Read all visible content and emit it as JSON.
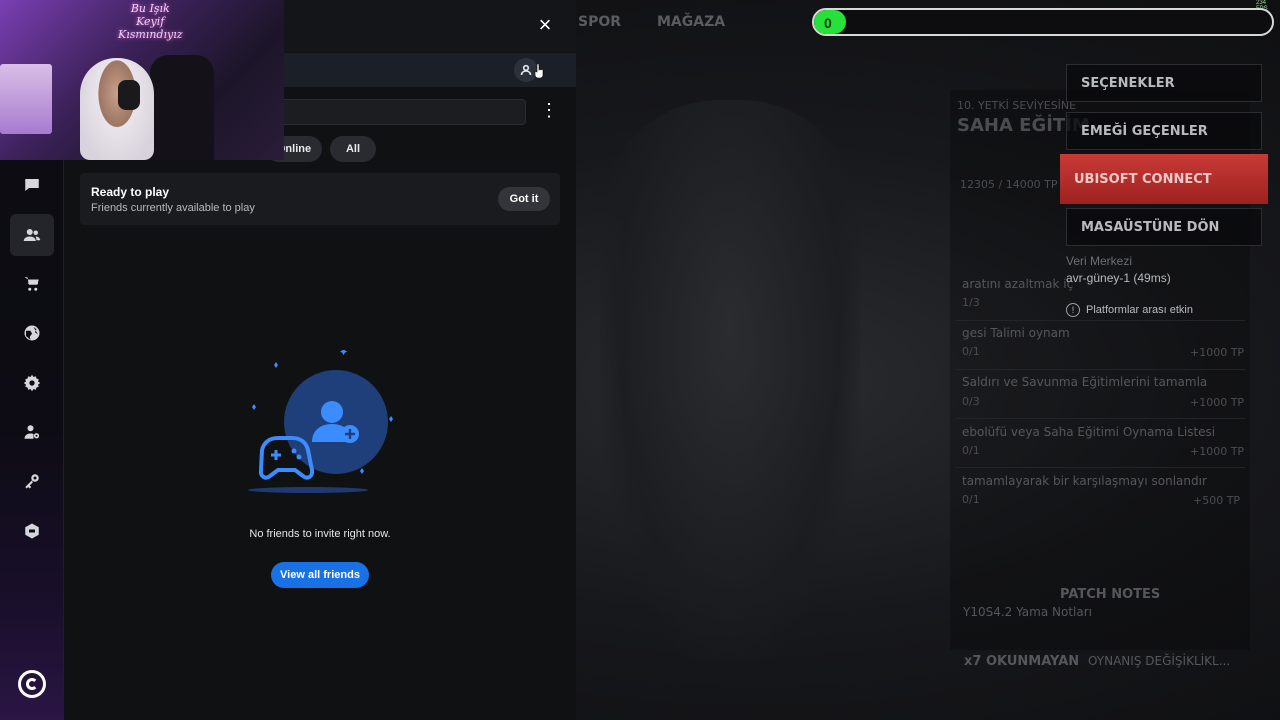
{
  "game": {
    "nav": [
      "SPOR",
      "MAĞAZA"
    ],
    "progress_value": "0",
    "progress_fraction": 0.07,
    "fps_label": "234 FPS",
    "left_column": {
      "rank_label": "10. YETKİ SEVİYESİNE",
      "training_title": "SAHA EĞİTİM",
      "tp_counter": "12305 / 14000 TP",
      "challenges": [
        {
          "text": "aratını azaltmak iç",
          "count": "1/3",
          "reward": ""
        },
        {
          "text": "gesi Talimi oynam",
          "count": "0/1",
          "reward": "+1000 TP"
        },
        {
          "text": "Saldırı ve Savunma Eğitimlerini tamamla",
          "count": "0/3",
          "reward": "+1000 TP"
        },
        {
          "text": "ebolüfü veya Saha Eğitimi Oynama Listesi",
          "count": "0/1",
          "reward": "+1000 TP"
        },
        {
          "text": "tamamlayarak bir karşılaşmayı sonlandır",
          "count": "0/1",
          "reward": "+500 TP"
        }
      ],
      "patch_notes_label": "PATCH NOTES",
      "patch_notes_value": "Y10S4.2 Yama Notları",
      "unread_label": "x7 OKUNMAYAN",
      "changes_label": "OYNANIŞ DEĞİŞİKLİKL..."
    },
    "menu": {
      "options": "SEÇENEKLER",
      "credits": "EMEĞİ GEÇENLER",
      "ubisoft_connect": "UBISOFT CONNECT",
      "desktop": "MASAÜSTÜNE DÖN"
    },
    "datacenter_title": "Veri Merkezi",
    "datacenter_value": "avr-güney-1 (49ms)",
    "crossplay": "Platformlar arası etkin"
  },
  "sidebar": {
    "items": [
      {
        "name": "chat-icon"
      },
      {
        "name": "friends-icon",
        "active": true
      },
      {
        "name": "cart-icon"
      },
      {
        "name": "globe-icon"
      },
      {
        "name": "gear-icon"
      },
      {
        "name": "account-settings-icon"
      },
      {
        "name": "key-icon"
      },
      {
        "name": "game-icon"
      }
    ],
    "logo": "ubisoft-logo"
  },
  "friends_panel": {
    "close_label": "×",
    "search_placeholder": "",
    "filters": [
      "Online",
      "All"
    ],
    "ready_card": {
      "title": "Ready to play",
      "subtitle": "Friends currently available to play",
      "button": "Got it"
    },
    "empty_message": "No friends to invite right now.",
    "view_all_button": "View all friends"
  },
  "webcam": {
    "sign_lines": [
      "Bu Işık",
      "Keyif",
      "Kısmındıyız"
    ]
  },
  "colors": {
    "accent_blue": "#1971e6",
    "progress_green": "#27e03a",
    "ubisoft_red": "#c93a36",
    "panel_bg": "#101113"
  }
}
